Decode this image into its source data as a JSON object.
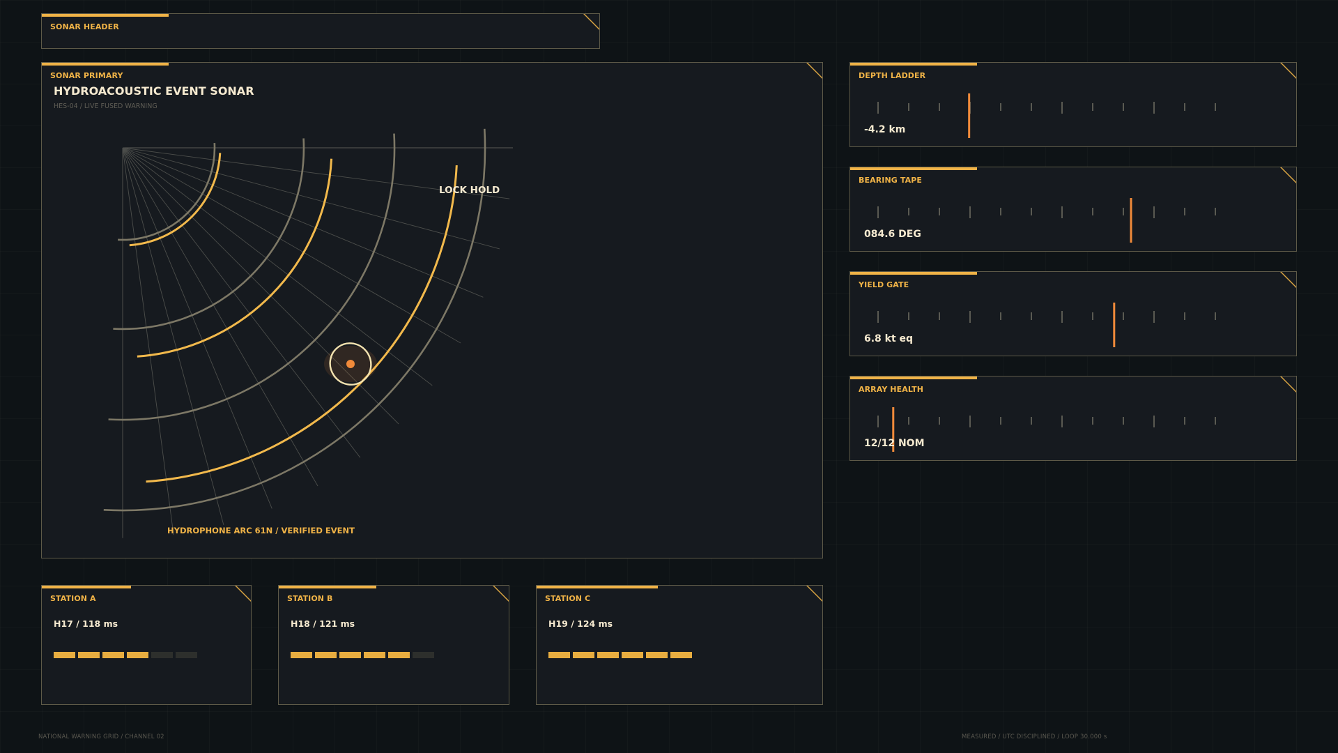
{
  "header_panel": {
    "label": "SONAR HEADER"
  },
  "sonar": {
    "label": "SONAR PRIMARY",
    "title": "HYDROACOUSTIC EVENT SONAR",
    "subtitle": "HES-04 / LIVE FUSED WARNING",
    "lock_label": "LOCK HOLD",
    "caption": "HYDROPHONE ARC 61N / VERIFIED EVENT"
  },
  "gauges": [
    {
      "label": "DEPTH LADDER",
      "value": "-4.2 km",
      "marker": 0.27
    },
    {
      "label": "BEARING TAPE",
      "value": "084.6 DEG",
      "marker": 0.75
    },
    {
      "label": "YIELD GATE",
      "value": "6.8 kt eq",
      "marker": 0.7
    },
    {
      "label": "ARRAY HEALTH",
      "value": "12/12 NOM",
      "marker": 0.045
    }
  ],
  "stations": [
    {
      "label": "STATION A",
      "value": "H17 / 118 ms",
      "segments_on": 4,
      "segments_total": 6
    },
    {
      "label": "STATION B",
      "value": "H18 / 121 ms",
      "segments_on": 5,
      "segments_total": 6
    },
    {
      "label": "STATION C",
      "value": "H19 / 124 ms",
      "segments_on": 6,
      "segments_total": 6
    }
  ],
  "footer": {
    "left": "NATIONAL WARNING GRID / CHANNEL 02",
    "right": "MEASURED / UTC DISCIPLINED / LOOP 30.000 s"
  },
  "colors": {
    "accent": "#f0b347",
    "marker": "#f08a3a",
    "panel": "#161a1f",
    "border": "#5e5a48",
    "text": "#f6ead0"
  }
}
